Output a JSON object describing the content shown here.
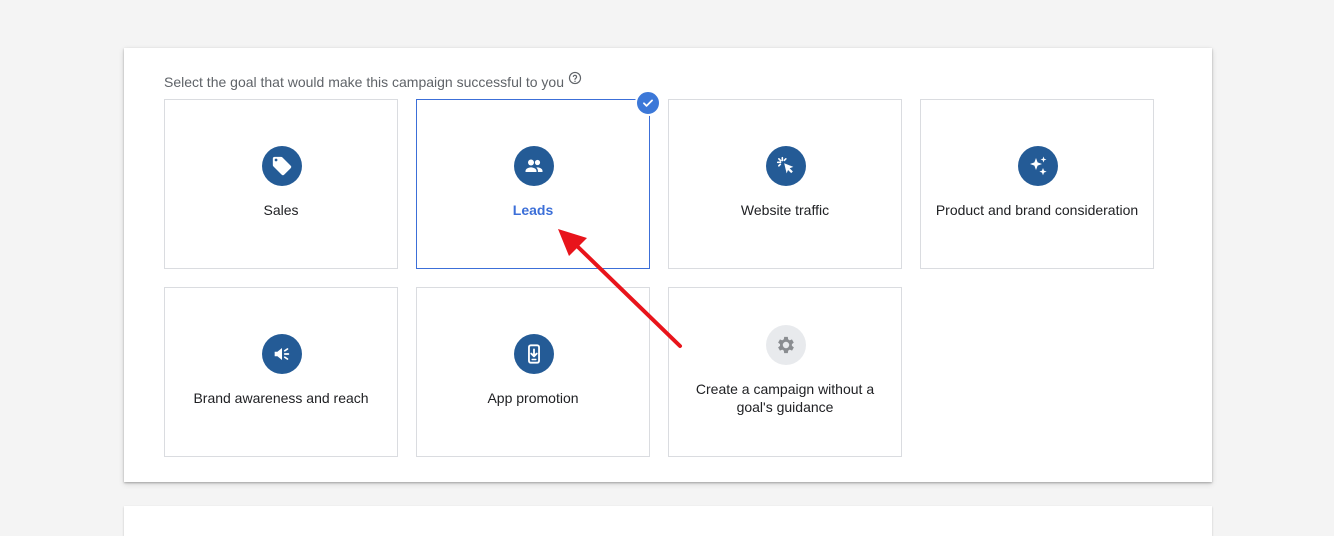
{
  "prompt": {
    "text": "Select the goal that would make this campaign successful to you",
    "help_icon": "help-circle-icon"
  },
  "goals": [
    {
      "label": "Sales",
      "icon": "tag-icon",
      "selected": false
    },
    {
      "label": "Leads",
      "icon": "people-icon",
      "selected": true
    },
    {
      "label": "Website traffic",
      "icon": "cursor-click-icon",
      "selected": false
    },
    {
      "label": "Product and brand consideration",
      "icon": "sparkle-icon",
      "selected": false
    },
    {
      "label": "Brand awareness and reach",
      "icon": "megaphone-icon",
      "selected": false
    },
    {
      "label": "App promotion",
      "icon": "phone-download-icon",
      "selected": false
    },
    {
      "label": "Create a campaign without a goal's guidance",
      "icon": "gear-icon",
      "selected": false
    }
  ],
  "colors": {
    "icon_background": "#245b96",
    "selected_accent": "#3c6fd8",
    "annotation_arrow": "#e8141b",
    "neutral_icon_background": "#e8eaed"
  }
}
